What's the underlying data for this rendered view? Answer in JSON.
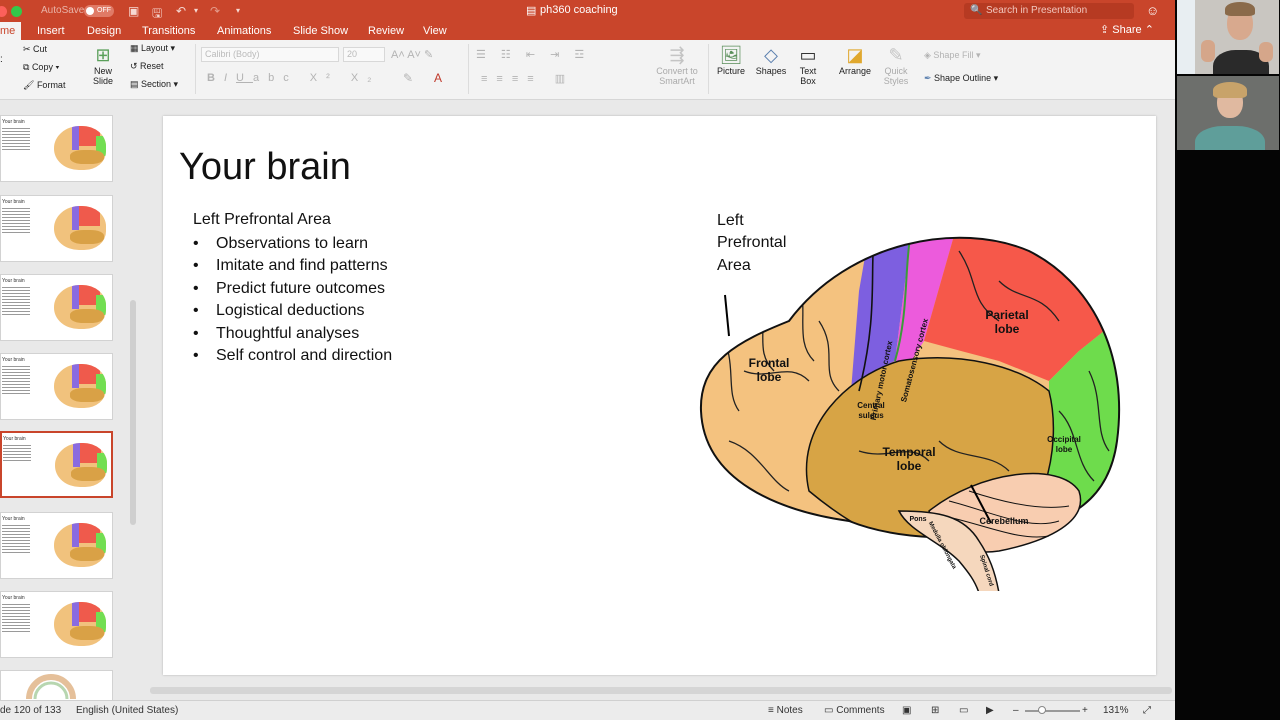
{
  "window": {
    "title": "ph360 coaching",
    "autosave_label": "AutoSave",
    "autosave_state": "OFF",
    "search_placeholder": "Search in Presentation",
    "share_label": "Share",
    "accent": "#c9452b"
  },
  "tabs": [
    {
      "label": "me",
      "active": true
    },
    {
      "label": "Insert"
    },
    {
      "label": "Design"
    },
    {
      "label": "Transitions"
    },
    {
      "label": "Animations"
    },
    {
      "label": "Slide Show"
    },
    {
      "label": "Review"
    },
    {
      "label": "View"
    }
  ],
  "ribbon": {
    "cut": "Cut",
    "copy": "Copy",
    "format": "Format",
    "new_slide_1": "New",
    "new_slide_2": "Slide",
    "layout": "Layout",
    "reset": "Reset",
    "section": "Section",
    "font_name": "Calibri (Body)",
    "font_size": "20",
    "convert_1": "Convert to",
    "convert_2": "SmartArt",
    "picture": "Picture",
    "shapes": "Shapes",
    "textbox_1": "Text",
    "textbox_2": "Box",
    "arrange": "Arrange",
    "quick_1": "Quick",
    "quick_2": "Styles",
    "shape_fill": "Shape Fill",
    "shape_outline": "Shape Outline"
  },
  "thumbnails": [
    {
      "title": "Your brain"
    },
    {
      "title": "Your brain"
    },
    {
      "title": "Your brain"
    },
    {
      "title": "Your brain"
    },
    {
      "title": "Your brain",
      "selected": true
    },
    {
      "title": "Your brain"
    },
    {
      "title": "Your brain"
    }
  ],
  "slide": {
    "title": "Your brain",
    "heading": "Left Prefrontal Area",
    "bullets": [
      "Observations to learn",
      "Imitate and find patterns",
      "Predict future outcomes",
      "Logistical deductions",
      "Thoughtful analyses",
      "Self control and direction"
    ],
    "callout": [
      "Left",
      "Prefrontal",
      "Area"
    ],
    "brain_labels": {
      "frontal_1": "Frontal",
      "frontal_2": "lobe",
      "motor": "Primary motor cortex",
      "somato": "Somatosensory cortex",
      "parietal_1": "Parietal",
      "parietal_2": "lobe",
      "central_1": "Central",
      "central_2": "sulcus",
      "temporal_1": "Temporal",
      "temporal_2": "lobe",
      "occipital_1": "Occipital",
      "occipital_2": "lobe",
      "pons": "Pons",
      "cerebellum": "Cerebellum",
      "medulla": "Medulla oblongata",
      "spinal": "Spinal cord"
    }
  },
  "status": {
    "slide_count": "de 120 of 133",
    "language": "English (United States)",
    "notes": "Notes",
    "comments": "Comments",
    "zoom": "131%"
  }
}
